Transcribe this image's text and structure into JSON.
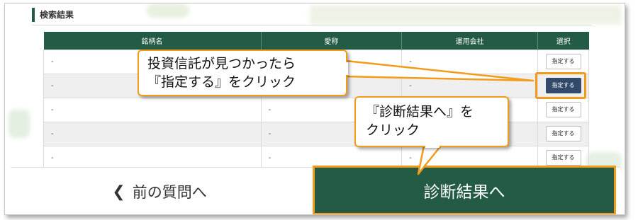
{
  "section": {
    "title": "検索結果"
  },
  "table": {
    "headers": [
      "銘柄名",
      "愛称",
      "運用会社",
      "選択"
    ],
    "rows": [
      {
        "name": "-",
        "nickname": "-",
        "company": "-",
        "button": "指定する"
      },
      {
        "name": "-",
        "nickname": "-",
        "company": "-",
        "button": "指定する"
      },
      {
        "name": "-",
        "nickname": "-",
        "company": "-",
        "button": "指定する"
      },
      {
        "name": "-",
        "nickname": "-",
        "company": "-",
        "button": "指定する"
      },
      {
        "name": "-",
        "nickname": "-",
        "company": "-",
        "button": "指定する"
      }
    ]
  },
  "nav": {
    "prev_label": "前の質問へ",
    "next_label": "診断結果へ"
  },
  "callouts": {
    "first": {
      "line1": "投資信託が見つかったら",
      "line2": "『指定する』をクリック"
    },
    "second": {
      "line1": "『診断結果へ』を",
      "line2": "クリック"
    }
  },
  "colors": {
    "brand_green": "#235b45",
    "highlight_orange": "#f39b1a",
    "active_button": "#334a6b"
  },
  "icons": {
    "prev": "chevron-left-icon"
  }
}
